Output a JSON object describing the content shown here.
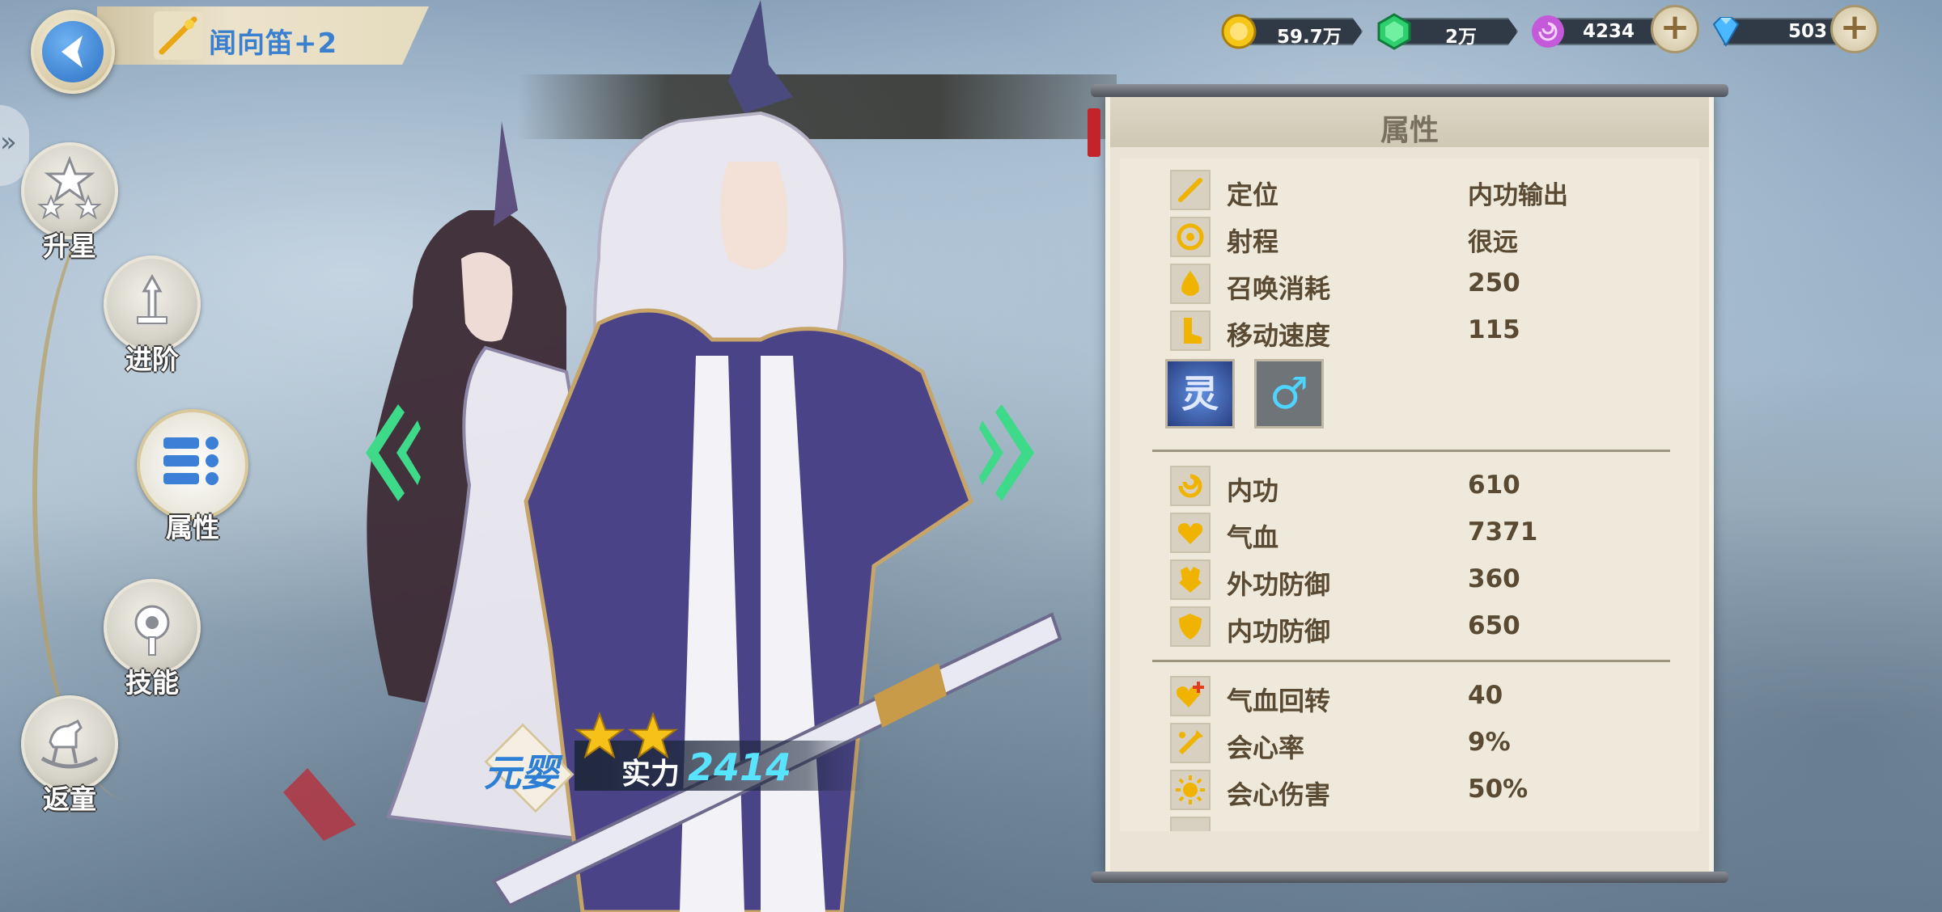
{
  "header": {
    "item_title": "闻向笛+2"
  },
  "resources": [
    {
      "name": "gold",
      "value": "59.7万",
      "color": "#f5c518",
      "icon": "gold-coin-icon"
    },
    {
      "name": "jade",
      "value": "2万",
      "color": "#2ecf6f",
      "icon": "green-gem-icon"
    },
    {
      "name": "spirit",
      "value": "4234",
      "color": "#c45ad9",
      "icon": "purple-swirl-icon",
      "has_plus": true
    },
    {
      "name": "diamond",
      "value": "503",
      "color": "#4cb8ff",
      "icon": "diamond-icon",
      "has_plus": true
    }
  ],
  "side_menu": [
    {
      "label": "升星",
      "icon": "stars-icon"
    },
    {
      "label": "进阶",
      "icon": "sword-up-icon"
    },
    {
      "label": "属性",
      "icon": "list-icon",
      "active": true
    },
    {
      "label": "技能",
      "icon": "skill-gear-icon"
    },
    {
      "label": "返童",
      "icon": "rocking-horse-icon"
    }
  ],
  "hero": {
    "stars": 2,
    "rank": "元婴",
    "power_label": "实力",
    "power_value": "2414"
  },
  "panel": {
    "title": "属性",
    "basic": [
      {
        "key": "定位",
        "value": "内功输出",
        "icon": "pen-icon"
      },
      {
        "key": "射程",
        "value": "很远",
        "icon": "target-icon"
      },
      {
        "key": "召唤消耗",
        "value": "250",
        "icon": "drop-icon"
      },
      {
        "key": "移动速度",
        "value": "115",
        "icon": "boot-icon"
      }
    ],
    "badges": [
      {
        "text": "灵",
        "icon": "spirit-badge-icon"
      },
      {
        "text": "♂",
        "icon": "male-icon"
      }
    ],
    "stats": [
      {
        "key": "内功",
        "value": "610",
        "icon": "swirl-icon"
      },
      {
        "key": "气血",
        "value": "7371",
        "icon": "heart-icon"
      },
      {
        "key": "外功防御",
        "value": "360",
        "icon": "armor-icon"
      },
      {
        "key": "内功防御",
        "value": "650",
        "icon": "shield-icon"
      }
    ],
    "extra": [
      {
        "key": "气血回转",
        "value": "40",
        "icon": "heart-plus-icon"
      },
      {
        "key": "会心率",
        "value": "9%",
        "icon": "crit-rate-icon"
      },
      {
        "key": "会心伤害",
        "value": "50%",
        "icon": "sun-icon"
      }
    ]
  },
  "colors": {
    "accent_gold": "#f0b400",
    "nav_green": "#3fd98a",
    "power_cyan": "#58e3ff",
    "title_blue": "#3b7fcf"
  }
}
